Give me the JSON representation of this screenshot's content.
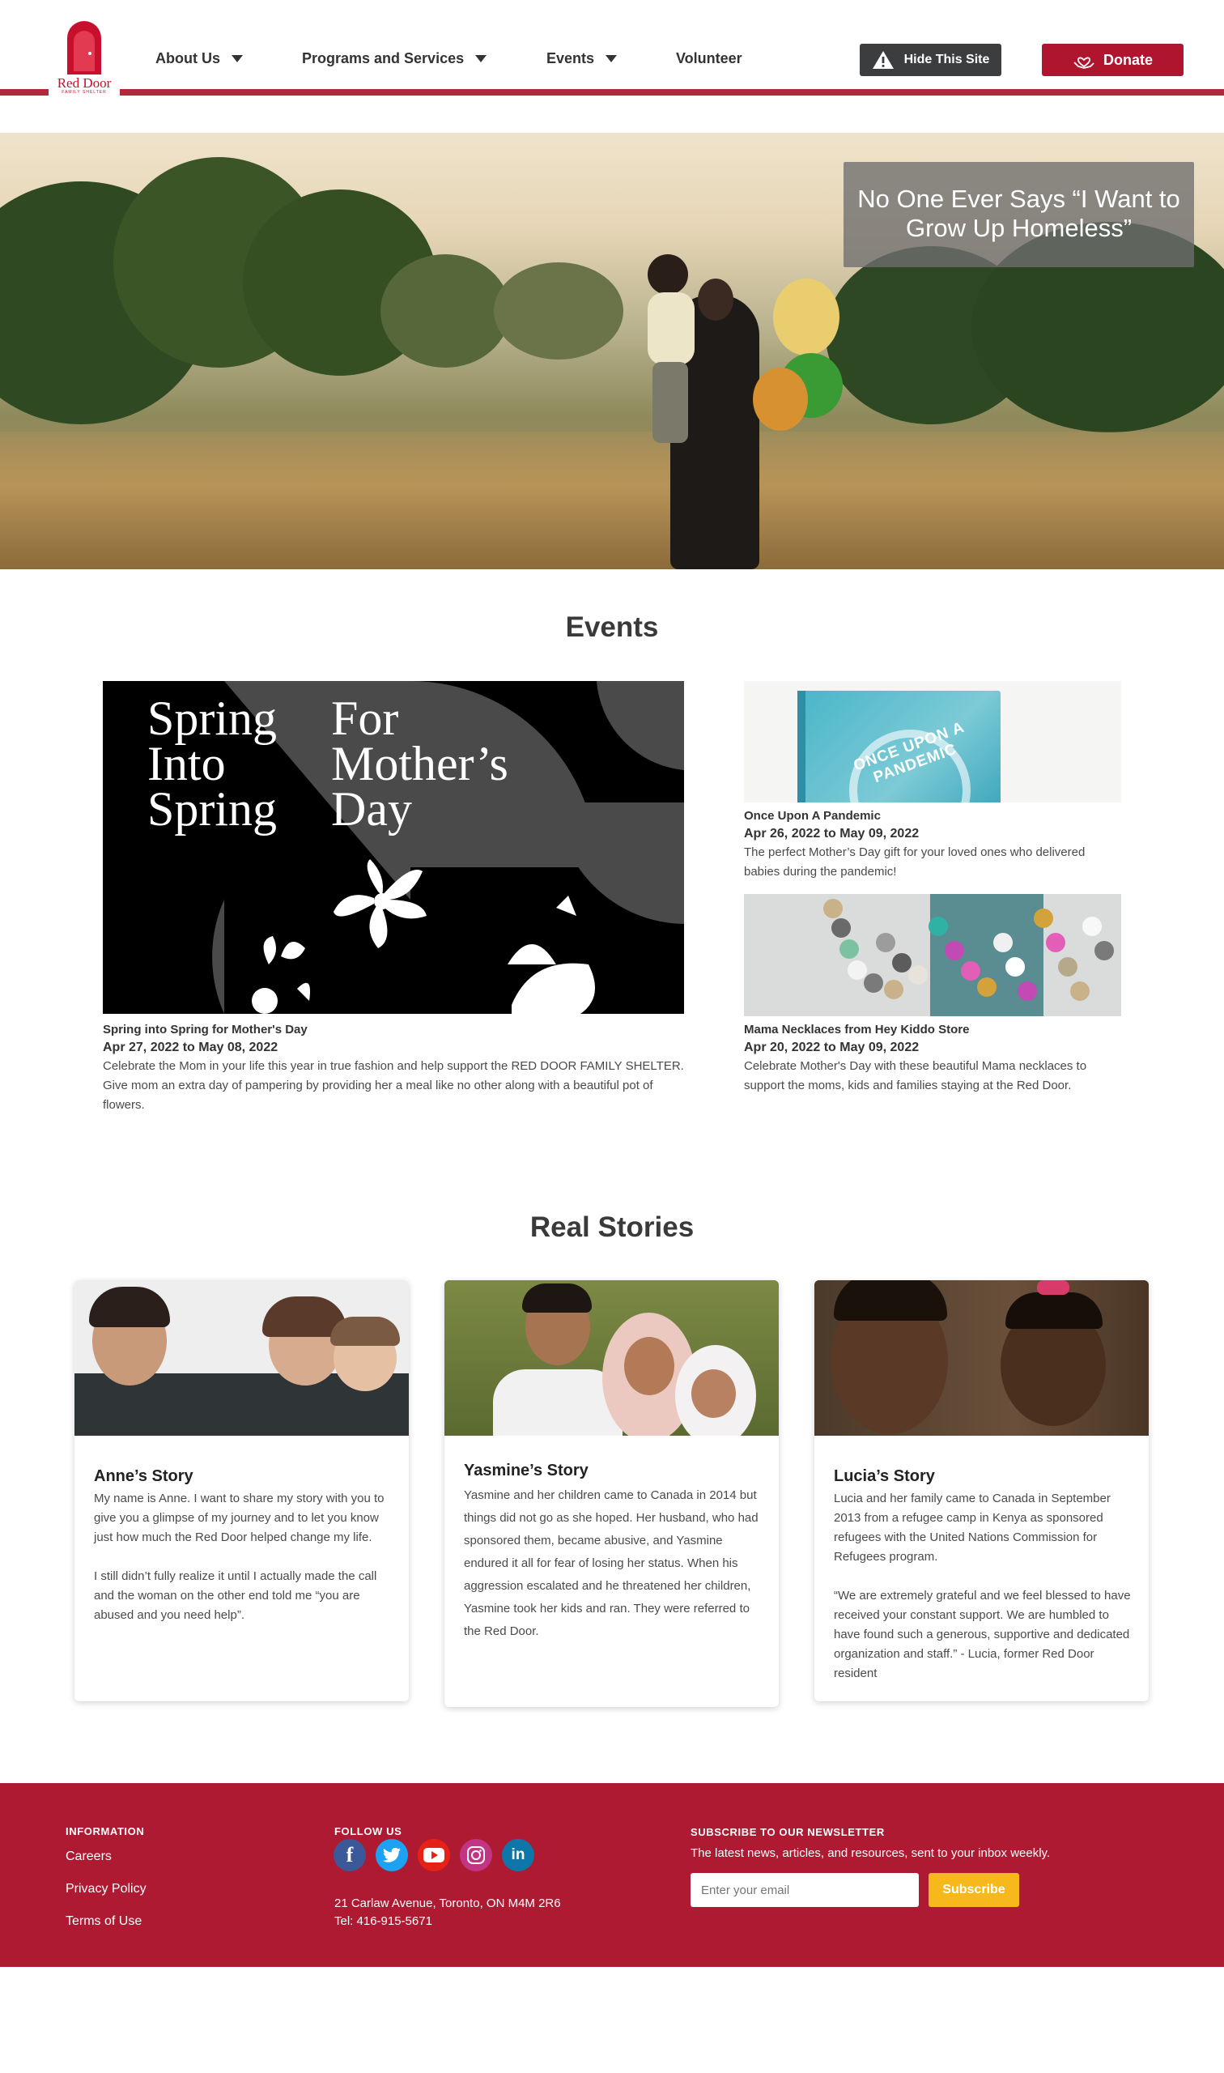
{
  "header": {
    "logo_text": "Red Door",
    "logo_sub": "FAMILY SHELTER",
    "nav": [
      {
        "label": "About Us",
        "dropdown": true
      },
      {
        "label": "Programs and Services",
        "dropdown": true
      },
      {
        "label": "Events",
        "dropdown": true
      },
      {
        "label": "Volunteer",
        "dropdown": false
      }
    ],
    "hide_site_label": "Hide This Site",
    "donate_label": "Donate",
    "brand_color": "#b4283c"
  },
  "hero": {
    "caption": "No One Ever Says “I Want to Grow Up Homeless”"
  },
  "events": {
    "title": "Events",
    "feature": {
      "image_text_left": [
        "Spring",
        "Into",
        "Spring"
      ],
      "image_text_right": [
        "For",
        "Mother’s",
        "Day"
      ],
      "title": "Spring into Spring for Mother's Day",
      "date": "Apr 27, 2022 to May 08, 2022",
      "description": "Celebrate the Mom in your life this year in true fashion and help support the RED DOOR FAMILY SHELTER. Give mom an extra day of pampering by providing her a meal like no other along with a beautiful pot of flowers."
    },
    "side": [
      {
        "image_text": "ONCE UPON A PANDEMIC",
        "title": "Once Upon A Pandemic",
        "date": "Apr 26, 2022 to May 09, 2022",
        "description": "The perfect Mother’s Day gift for your loved ones who delivered babies during the pandemic!"
      },
      {
        "title": "Mama Necklaces from Hey Kiddo Store",
        "date": "Apr 20, 2022 to May 09, 2022",
        "description": "Celebrate Mother's Day with these beautiful Mama necklaces to support the moms, kids and families staying at the Red Door."
      }
    ]
  },
  "stories": {
    "title": "Real Stories",
    "cards": [
      {
        "title": "Anne’s Story",
        "paragraphs": [
          "My name is Anne. I want to share my story with you to give you a glimpse of my journey and to let you know just how much the Red Door helped change my life.",
          "I still didn’t fully realize it until I actually made the call and the woman on the other end told me “you are abused and you need help”."
        ]
      },
      {
        "title": "Yasmine’s Story",
        "paragraphs": [
          "Yasmine and her children came to Canada in 2014 but things did not go as she hoped. Her husband, who had sponsored them, became abusive, and Yasmine endured it all for fear of losing her status. When his aggression escalated and he threatened her children, Yasmine took her kids and ran. They were referred to the Red Door."
        ]
      },
      {
        "title": "Lucia’s Story",
        "paragraphs": [
          "Lucia and her family came to Canada in September 2013 from a refugee camp in Kenya as sponsored refugees with the United Nations Commission for Refugees program.",
          "“We are extremely grateful and we feel blessed to have received your constant support. We are humbled to have found such a generous, supportive and dedicated organization and staff.” - Lucia, former Red Door resident"
        ]
      }
    ]
  },
  "footer": {
    "info_heading": "INFORMATION",
    "info_links": [
      "Careers",
      "Privacy Policy",
      "Terms of Use"
    ],
    "follow_heading": "FOLLOW US",
    "social": [
      {
        "icon": "facebook-icon",
        "glyph": "f",
        "color": "#3b5998"
      },
      {
        "icon": "twitter-icon",
        "glyph": "t",
        "color": "#1da1f2"
      },
      {
        "icon": "youtube-icon",
        "glyph": "▶",
        "color": "#e62117"
      },
      {
        "icon": "instagram-icon",
        "glyph": "◎",
        "color": "#c13584"
      },
      {
        "icon": "linkedin-icon",
        "glyph": "in",
        "color": "#0e76a8"
      }
    ],
    "address": "21 Carlaw Avenue, Toronto, ON M4M 2R6",
    "phone": "Tel: 416-915-5671",
    "newsletter_heading": "SUBSCRIBE TO OUR NEWSLETTER",
    "newsletter_text": "The latest news, articles, and resources, sent to your inbox weekly.",
    "email_placeholder": "Enter your email",
    "subscribe_label": "Subscribe",
    "background_color": "#ae1a31",
    "subscribe_color": "#f6b81a"
  }
}
